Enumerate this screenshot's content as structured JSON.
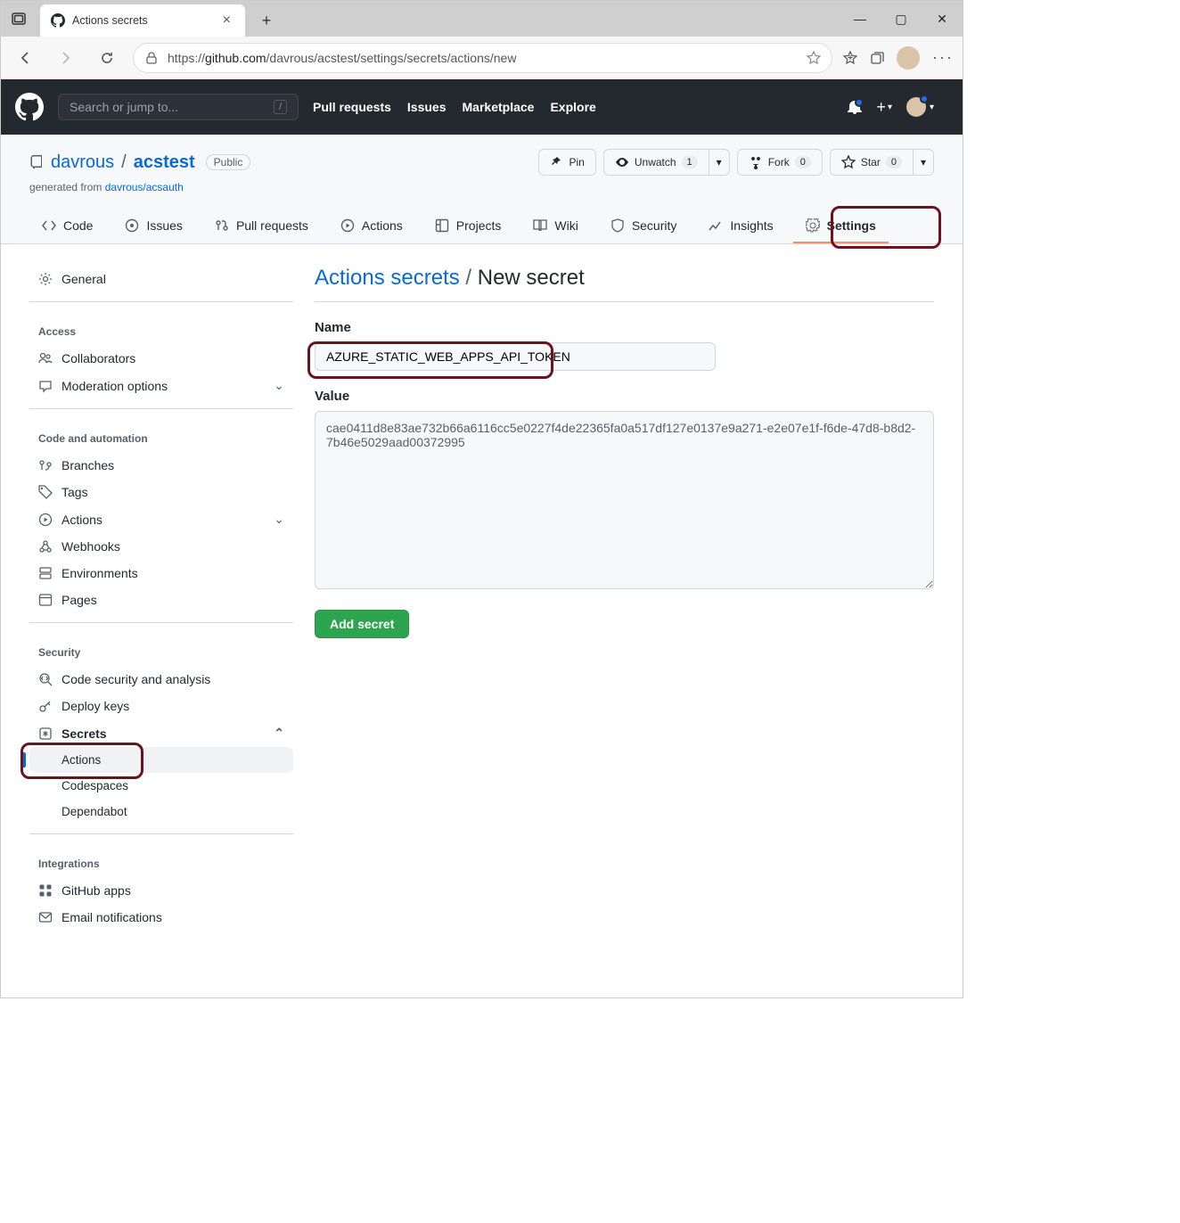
{
  "browser": {
    "tab_title": "Actions secrets",
    "url_prefix": "https://",
    "url_domain": "github.com",
    "url_path": "/davrous/acstest/settings/secrets/actions/new"
  },
  "github_header": {
    "search_placeholder": "Search or jump to...",
    "nav": {
      "pull_requests": "Pull requests",
      "issues": "Issues",
      "marketplace": "Marketplace",
      "explore": "Explore"
    }
  },
  "repo": {
    "owner": "davrous",
    "name": "acstest",
    "visibility": "Public",
    "generated_text": "generated from ",
    "generated_link": "davrous/acsauth",
    "actions": {
      "pin": "Pin",
      "unwatch": "Unwatch",
      "unwatch_count": "1",
      "fork": "Fork",
      "fork_count": "0",
      "star": "Star",
      "star_count": "0"
    },
    "tabs": {
      "code": "Code",
      "issues": "Issues",
      "pull_requests": "Pull requests",
      "actions": "Actions",
      "projects": "Projects",
      "wiki": "Wiki",
      "security": "Security",
      "insights": "Insights",
      "settings": "Settings"
    }
  },
  "sidebar": {
    "general": "General",
    "access_header": "Access",
    "collaborators": "Collaborators",
    "moderation": "Moderation options",
    "code_header": "Code and automation",
    "branches": "Branches",
    "tags": "Tags",
    "actions": "Actions",
    "webhooks": "Webhooks",
    "environments": "Environments",
    "pages": "Pages",
    "security_header": "Security",
    "code_security": "Code security and analysis",
    "deploy_keys": "Deploy keys",
    "secrets": "Secrets",
    "secrets_actions": "Actions",
    "secrets_codespaces": "Codespaces",
    "secrets_dependabot": "Dependabot",
    "integrations_header": "Integrations",
    "github_apps": "GitHub apps",
    "email": "Email notifications"
  },
  "page": {
    "breadcrumb": "Actions secrets",
    "title": "New secret",
    "name_label": "Name",
    "name_value": "AZURE_STATIC_WEB_APPS_API_TOKEN",
    "value_label": "Value",
    "value_text": "cae0411d8e83ae732b66a6116cc5e0227f4de22365fa0a517df127e0137e9a271-e2e07e1f-f6de-47d8-b8d2-7b46e5029aad00372995",
    "submit": "Add secret"
  }
}
